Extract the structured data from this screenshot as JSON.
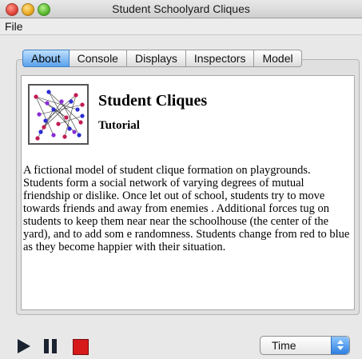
{
  "window": {
    "title": "Student Schoolyard Cliques"
  },
  "menubar": {
    "items": [
      "File"
    ]
  },
  "tabs": [
    {
      "label": "About",
      "active": true
    },
    {
      "label": "Console",
      "active": false
    },
    {
      "label": "Displays",
      "active": false
    },
    {
      "label": "Inspectors",
      "active": false
    },
    {
      "label": "Model",
      "active": false
    }
  ],
  "about": {
    "title": "Student Cliques",
    "subtitle": "Tutorial",
    "description": "A fictional model of student clique formation on playgrounds. Students form a social network of varying degrees of mutual friendship or dislike. Once let out of school, students try to move towards friends and away from enemies . Additional forces tug on students to keep them near near the schoolhouse (the center of the yard), and to add som e randomness. Students change from red to blue as they become happier with their situation."
  },
  "controls": {
    "play_icon": "play-icon",
    "pause_icon": "pause-icon",
    "stop_icon": "stop-icon",
    "time_select": {
      "selected": "Time",
      "options": [
        "Time"
      ]
    }
  },
  "colors": {
    "active_tab": "#5aa2ea",
    "stop": "#d61a1a",
    "thumb_red": "#c21b4f",
    "thumb_blue": "#2b2bd6"
  }
}
